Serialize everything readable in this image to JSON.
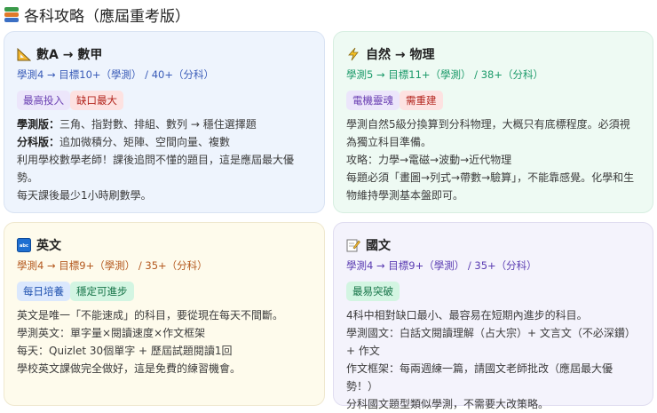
{
  "page_title": "各科攻略（應屆重考版）",
  "cards": [
    {
      "icon": "triangle-ruler-icon",
      "title": "數A → 數甲",
      "score": "學測4 → 目標10+（學測） / 40+（分科）",
      "score_color": "#3a5cb8",
      "tags": [
        {
          "label": "最高投入",
          "bg": "#ece6fb",
          "fg": "#6a3fb2"
        },
        {
          "label": "缺口最大",
          "bg": "#fde2e1",
          "fg": "#b3261e"
        }
      ],
      "lines": [
        {
          "bold": "學測版：",
          "text": "三角、指對數、排組、數列 → 穩住選擇題"
        },
        {
          "bold": "分科版：",
          "text": "追加微積分、矩陣、空間向量、複數"
        },
        {
          "bold": "",
          "text": "利用學校數學老師！課後追問不懂的題目，這是應屆最大優勢。"
        },
        {
          "bold": "",
          "text": "每天課後最少1小時刷數學。"
        }
      ]
    },
    {
      "icon": "lightning-icon",
      "title": "自然 → 物理",
      "score": "學測5 → 目標11+（學測） / 38+（分科）",
      "score_color": "#1c9a6a",
      "tags": [
        {
          "label": "電機靈魂",
          "bg": "#ece6fb",
          "fg": "#6a3fb2"
        },
        {
          "label": "需重建",
          "bg": "#fde2e1",
          "fg": "#b3261e"
        }
      ],
      "lines": [
        {
          "bold": "",
          "text": "學測自然5級分換算到分科物理，大概只有底標程度。必須視為獨立科目準備。"
        },
        {
          "bold": "",
          "text": "攻略：力學→電磁→波動→近代物理"
        },
        {
          "bold": "",
          "text": "每題必須「畫圖→列式→帶數→驗算」，不能靠感覺。化學和生物維持學測基本盤即可。"
        }
      ]
    },
    {
      "icon": "abc-icon",
      "title": "英文",
      "score": "學測4 → 目標9+（學測） / 35+（分科）",
      "score_color": "#b4591f",
      "tags": [
        {
          "label": "每日培養",
          "bg": "#dbe8fd",
          "fg": "#1d4fae"
        },
        {
          "label": "穩定可進步",
          "bg": "#d3f5e2",
          "fg": "#157347"
        }
      ],
      "lines": [
        {
          "bold": "",
          "text": "英文是唯一「不能速成」的科目，要從現在每天不間斷。"
        },
        {
          "bold": "",
          "text": "學測英文：單字量×閱讀速度×作文框架"
        },
        {
          "bold": "",
          "text": "每天：Quizlet 30個單字 + 歷屆試題閱讀1回"
        },
        {
          "bold": "",
          "text": "學校英文課做完全做好，這是免費的練習機會。"
        }
      ]
    },
    {
      "icon": "memo-icon",
      "title": "國文",
      "score": "學測4 → 目標9+（學測） / 35+（分科）",
      "score_color": "#5b3db2",
      "tags": [
        {
          "label": "最易突破",
          "bg": "#d3f5e2",
          "fg": "#157347"
        }
      ],
      "lines": [
        {
          "bold": "",
          "text": "4科中相對缺口最小、最容易在短期內進步的科目。"
        },
        {
          "bold": "",
          "text": "學測國文：白話文閱讀理解（占大宗）+ 文言文（不必深鑽）+ 作文"
        },
        {
          "bold": "",
          "text": "作文框架：每兩週練一篇，請國文老師批改（應屆最大優勢！）"
        },
        {
          "bold": "",
          "text": "分科國文題型類似學測，不需要大改策略。"
        }
      ]
    }
  ]
}
